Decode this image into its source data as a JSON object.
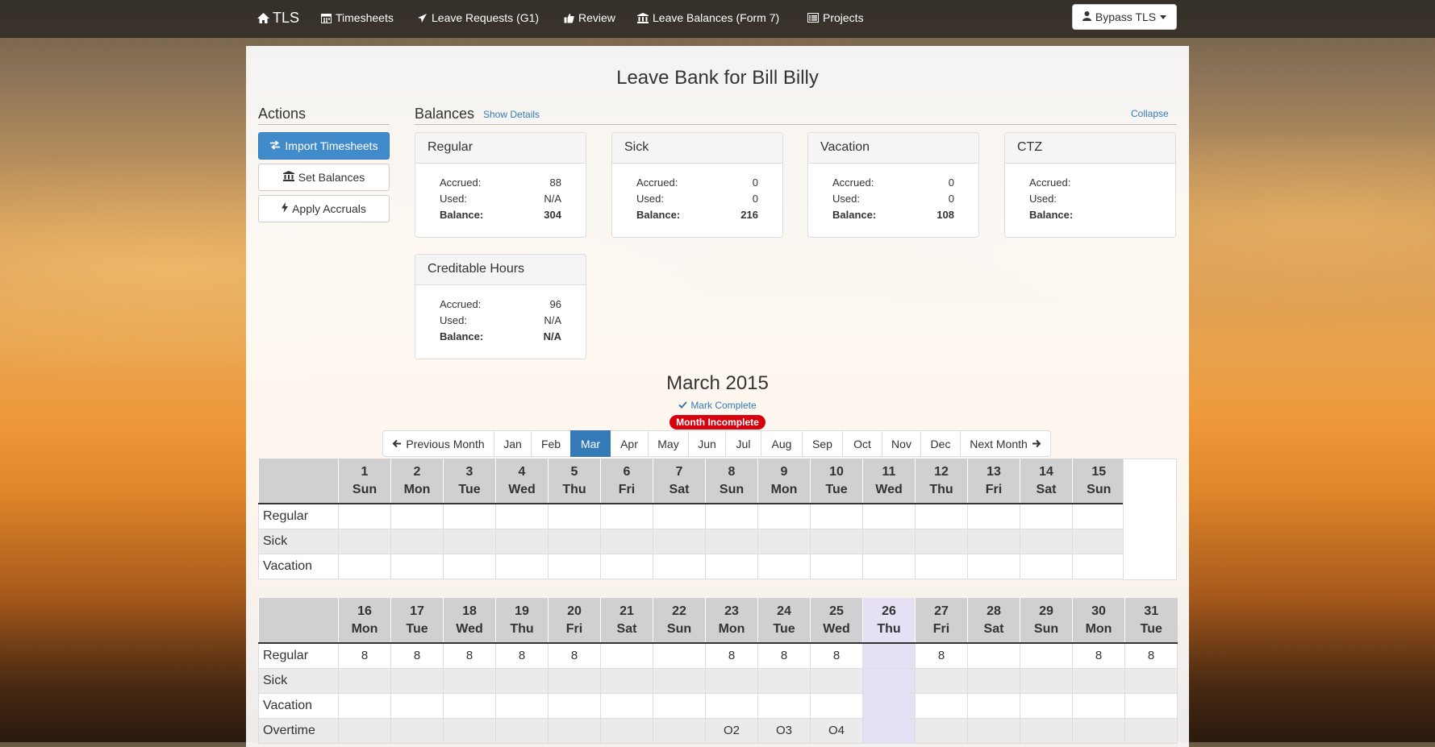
{
  "nav": {
    "brand": "TLS",
    "items": [
      {
        "label": "Timesheets",
        "icon": "calendar-icon"
      },
      {
        "label": "Leave Requests (G1)",
        "icon": "plane-icon"
      },
      {
        "label": "Review",
        "icon": "thumbs-up-icon"
      },
      {
        "label": "Leave Balances (Form 7)",
        "icon": "bank-icon"
      },
      {
        "label": "Projects",
        "icon": "list-icon"
      }
    ],
    "user_button": "Bypass TLS"
  },
  "page": {
    "title": "Leave Bank for Bill Billy"
  },
  "actions": {
    "heading": "Actions",
    "buttons": [
      {
        "label": "Import Timesheets",
        "icon": "transfer-icon"
      },
      {
        "label": "Set Balances",
        "icon": "bank-icon"
      },
      {
        "label": "Apply Accruals",
        "icon": "flash-icon"
      }
    ]
  },
  "balances": {
    "heading": "Balances",
    "show_details": "Show Details",
    "collapse": "Collapse",
    "labels": {
      "accrued": "Accrued:",
      "used": "Used:",
      "balance": "Balance:"
    },
    "cards": [
      {
        "title": "Regular",
        "accrued": "88",
        "used": "N/A",
        "balance": "304"
      },
      {
        "title": "Sick",
        "accrued": "0",
        "used": "0",
        "balance": "216"
      },
      {
        "title": "Vacation",
        "accrued": "0",
        "used": "0",
        "balance": "108"
      },
      {
        "title": "CTZ",
        "accrued": "",
        "used": "",
        "balance": ""
      },
      {
        "title": "Creditable Hours",
        "accrued": "96",
        "used": "N/A",
        "balance": "N/A"
      }
    ]
  },
  "calendar": {
    "title": "March 2015",
    "mark_complete": "Mark Complete",
    "status_badge": "Month Incomplete",
    "pager": {
      "prev": "Previous Month",
      "next": "Next Month",
      "months": [
        "Jan",
        "Feb",
        "Mar",
        "Apr",
        "May",
        "Jun",
        "Jul",
        "Aug",
        "Sep",
        "Oct",
        "Nov",
        "Dec"
      ],
      "active": "Mar"
    },
    "row_labels": [
      "Regular",
      "Sick",
      "Vacation",
      "Overtime"
    ],
    "week1": {
      "days": [
        {
          "num": "1",
          "dow": "Sun"
        },
        {
          "num": "2",
          "dow": "Mon"
        },
        {
          "num": "3",
          "dow": "Tue"
        },
        {
          "num": "4",
          "dow": "Wed"
        },
        {
          "num": "5",
          "dow": "Thu"
        },
        {
          "num": "6",
          "dow": "Fri"
        },
        {
          "num": "7",
          "dow": "Sat"
        },
        {
          "num": "8",
          "dow": "Sun"
        },
        {
          "num": "9",
          "dow": "Mon"
        },
        {
          "num": "10",
          "dow": "Tue"
        },
        {
          "num": "11",
          "dow": "Wed"
        },
        {
          "num": "12",
          "dow": "Thu"
        },
        {
          "num": "13",
          "dow": "Fri"
        },
        {
          "num": "14",
          "dow": "Sat"
        },
        {
          "num": "15",
          "dow": "Sun"
        }
      ],
      "rows": [
        {
          "label": "Regular",
          "values": [
            "",
            "",
            "",
            "",
            "",
            "",
            "",
            "",
            "",
            "",
            "",
            "",
            "",
            "",
            ""
          ]
        },
        {
          "label": "Sick",
          "values": [
            "",
            "",
            "",
            "",
            "",
            "",
            "",
            "",
            "",
            "",
            "",
            "",
            "",
            "",
            ""
          ]
        },
        {
          "label": "Vacation",
          "values": [
            "",
            "",
            "",
            "",
            "",
            "",
            "",
            "",
            "",
            "",
            "",
            "",
            "",
            "",
            ""
          ]
        }
      ]
    },
    "week2": {
      "today_index": 10,
      "days": [
        {
          "num": "16",
          "dow": "Mon"
        },
        {
          "num": "17",
          "dow": "Tue"
        },
        {
          "num": "18",
          "dow": "Wed"
        },
        {
          "num": "19",
          "dow": "Thu"
        },
        {
          "num": "20",
          "dow": "Fri"
        },
        {
          "num": "21",
          "dow": "Sat"
        },
        {
          "num": "22",
          "dow": "Sun"
        },
        {
          "num": "23",
          "dow": "Mon"
        },
        {
          "num": "24",
          "dow": "Tue"
        },
        {
          "num": "25",
          "dow": "Wed"
        },
        {
          "num": "26",
          "dow": "Thu"
        },
        {
          "num": "27",
          "dow": "Fri"
        },
        {
          "num": "28",
          "dow": "Sat"
        },
        {
          "num": "29",
          "dow": "Sun"
        },
        {
          "num": "30",
          "dow": "Mon"
        },
        {
          "num": "31",
          "dow": "Tue"
        }
      ],
      "rows": [
        {
          "label": "Regular",
          "values": [
            "8",
            "8",
            "8",
            "8",
            "8",
            "",
            "",
            "8",
            "8",
            "8",
            "",
            "8",
            "",
            "",
            "8",
            "8"
          ]
        },
        {
          "label": "Sick",
          "values": [
            "",
            "",
            "",
            "",
            "",
            "",
            "",
            "",
            "",
            "",
            "",
            "",
            "",
            "",
            "",
            ""
          ]
        },
        {
          "label": "Vacation",
          "values": [
            "",
            "",
            "",
            "",
            "",
            "",
            "",
            "",
            "",
            "",
            "",
            "",
            "",
            "",
            "",
            ""
          ]
        },
        {
          "label": "Overtime",
          "values": [
            "",
            "",
            "",
            "",
            "",
            "",
            "",
            "O2",
            "O3",
            "O4",
            "",
            "",
            "",
            "",
            "",
            ""
          ]
        }
      ]
    }
  },
  "colors": {
    "primary": "#428bca",
    "active_page": "#337ab7",
    "link": "#337ab7",
    "badge_red": "#d9000d",
    "today_highlight": "#e6e0f5",
    "header_gray": "#d0d0d0"
  }
}
